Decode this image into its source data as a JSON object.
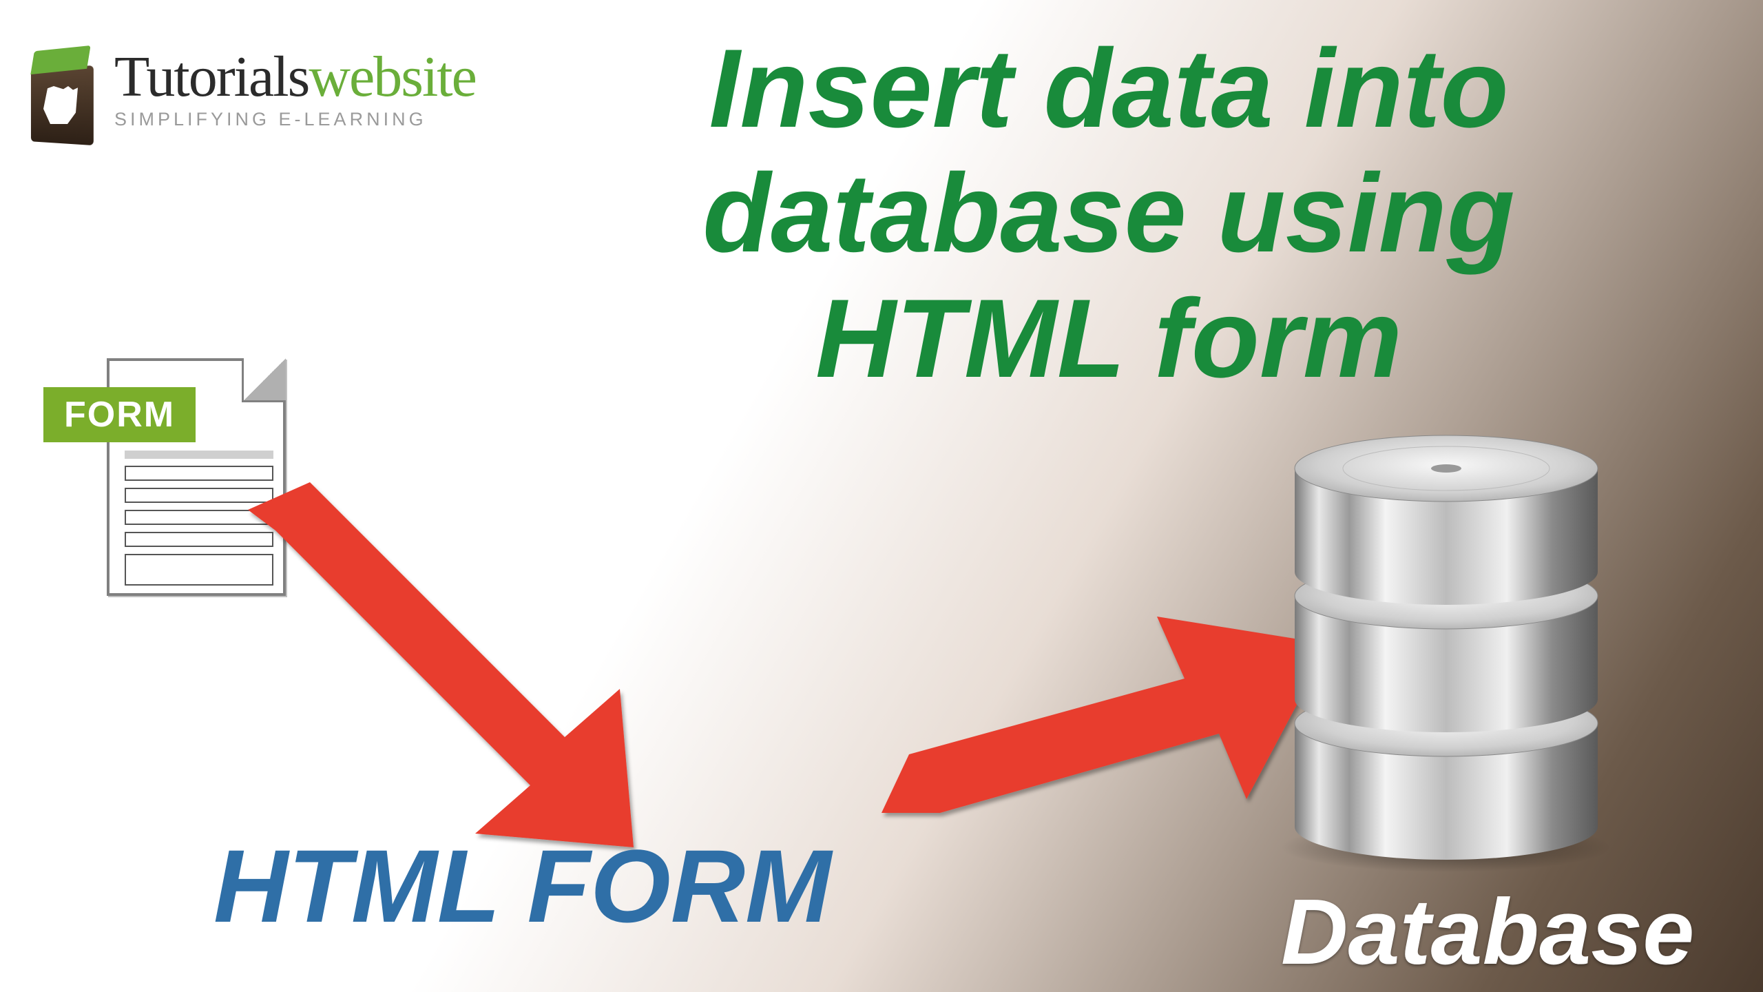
{
  "logo": {
    "brand_tutorials": "Tutorials",
    "brand_website": "website",
    "tagline": "SIMPLIFYING E-LEARNING"
  },
  "title": {
    "line1": "Insert data into",
    "line2": "database using",
    "line3": "HTML  form"
  },
  "form_badge": "FORM",
  "html_form_label": "HTML FORM",
  "database_label": "Database",
  "colors": {
    "title_green": "#198B3B",
    "logo_green": "#6AAE3A",
    "badge_green": "#7BAE2B",
    "arrow_red": "#E83C2E",
    "html_blue": "#2F6FA7"
  }
}
